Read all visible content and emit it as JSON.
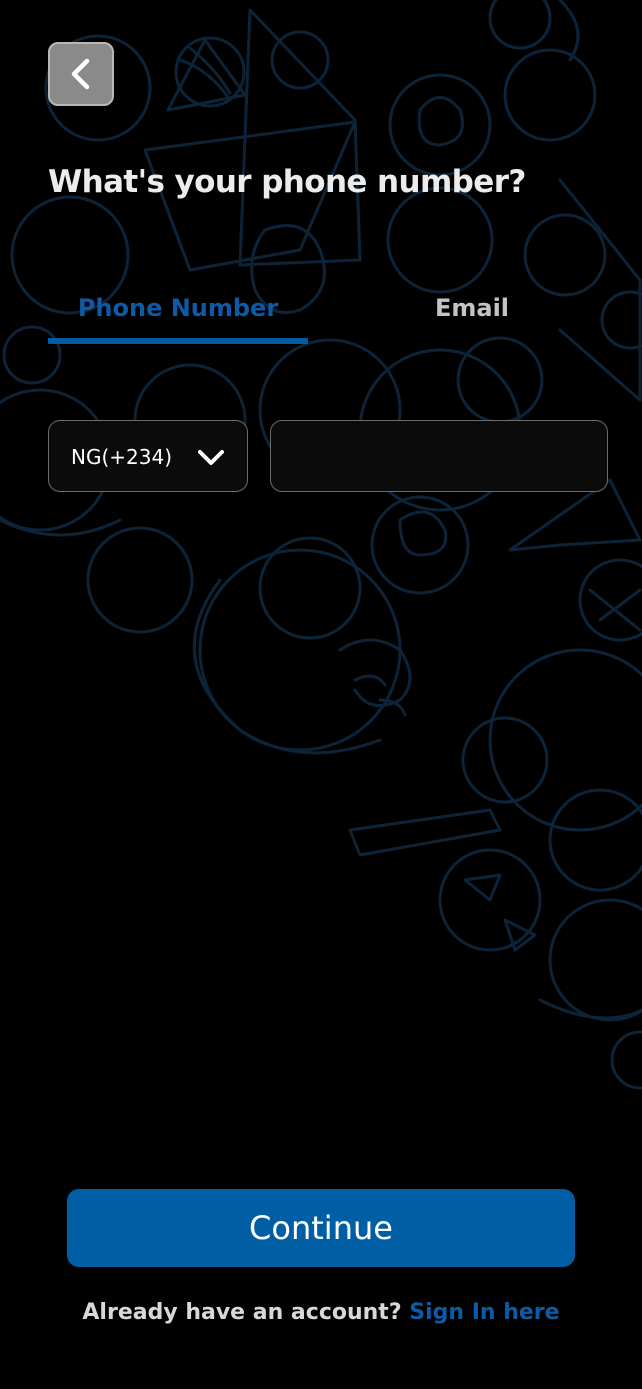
{
  "header": {
    "back_icon": "chevron-left-icon",
    "title": "What's your phone number?"
  },
  "tabs": {
    "items": [
      {
        "label": "Phone Number",
        "active": true
      },
      {
        "label": "Email",
        "active": false
      }
    ],
    "active_color": "#005ca3",
    "inactive_color": "#c4c4c4"
  },
  "form": {
    "country_code": {
      "value": "NG(+234)",
      "icon": "chevron-down-icon"
    },
    "phone": {
      "value": "",
      "placeholder": ""
    }
  },
  "footer": {
    "continue_label": "Continue",
    "signin_prompt": "Already have an account?",
    "signin_link": "Sign In here"
  },
  "colors": {
    "background": "#000000",
    "accent": "#005ea4",
    "pattern_stroke": "#0d2438"
  }
}
